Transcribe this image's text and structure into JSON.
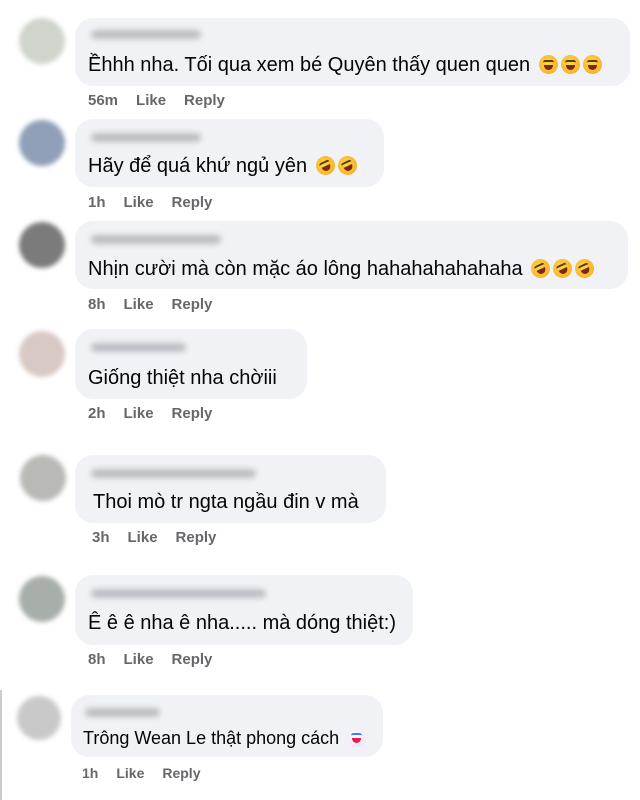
{
  "comments": [
    {
      "text": "Ềhhh nha. Tối qua xem bé Quyên thấy quen quen",
      "emoji": [
        "joy",
        "joy",
        "joy"
      ],
      "time": "56m",
      "like": "Like",
      "reply": "Reply",
      "avatar_color": "#cfd5cc"
    },
    {
      "text": "Hãy để quá khứ ngủ yên",
      "emoji": [
        "rofl",
        "rofl"
      ],
      "time": "1h",
      "like": "Like",
      "reply": "Reply",
      "avatar_color": "#8fa0b8"
    },
    {
      "text": "Nhịn cười mà còn mặc áo lông hahahahahahaha",
      "emoji": [
        "rofl",
        "rofl",
        "rofl"
      ],
      "time": "8h",
      "like": "Like",
      "reply": "Reply",
      "avatar_color": "#7b7b7b"
    },
    {
      "text": "Giống thiệt nha chờiii",
      "emoji": [],
      "time": "2h",
      "like": "Like",
      "reply": "Reply",
      "avatar_color": "#d9c9c4"
    },
    {
      "text": "Thoi mò tr ngta ngầu đin v mà",
      "emoji": [],
      "time": "3h",
      "like": "Like",
      "reply": "Reply",
      "avatar_color": "#b9b9b6"
    },
    {
      "text": "Ê ê ê nha ê nha..... mà dóng thiệt:)",
      "emoji": [],
      "time": "8h",
      "like": "Like",
      "reply": "Reply",
      "avatar_color": "#a8aeaa"
    },
    {
      "text": "Trông Wean Le thật phong cách",
      "emoji": [
        "clown"
      ],
      "time": "1h",
      "like": "Like",
      "reply": "Reply",
      "avatar_color": "#c9c9c9"
    }
  ]
}
